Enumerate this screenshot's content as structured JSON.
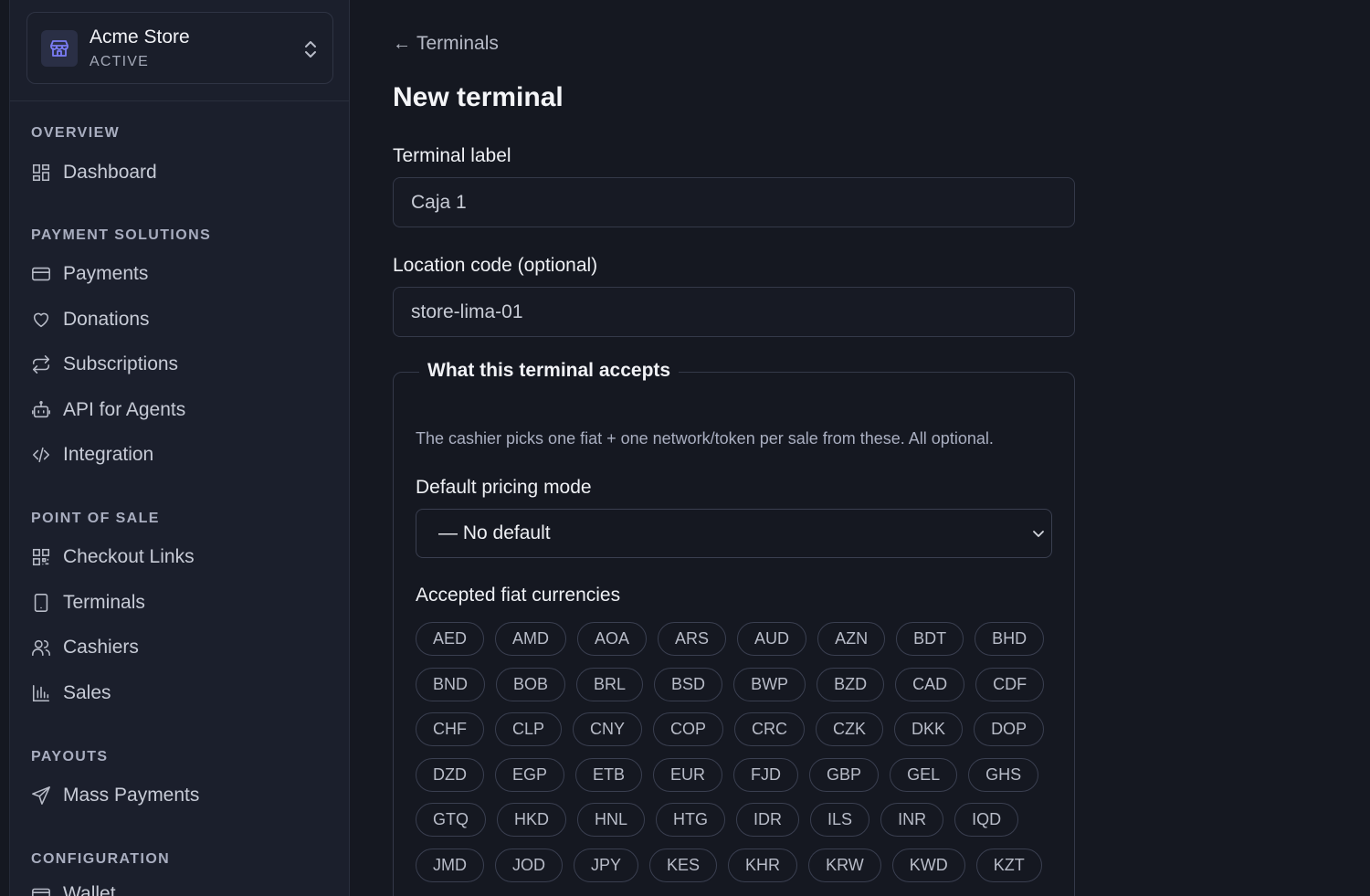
{
  "store": {
    "name": "Acme Store",
    "status": "ACTIVE"
  },
  "sidebar": {
    "sections": [
      {
        "title": "OVERVIEW",
        "items": [
          {
            "label": "Dashboard",
            "icon": "dashboard-icon"
          }
        ]
      },
      {
        "title": "PAYMENT SOLUTIONS",
        "items": [
          {
            "label": "Payments",
            "icon": "credit-card-icon"
          },
          {
            "label": "Donations",
            "icon": "heart-icon"
          },
          {
            "label": "Subscriptions",
            "icon": "repeat-icon"
          },
          {
            "label": "API for Agents",
            "icon": "robot-icon"
          },
          {
            "label": "Integration",
            "icon": "code-icon"
          }
        ]
      },
      {
        "title": "POINT OF SALE",
        "items": [
          {
            "label": "Checkout Links",
            "icon": "qr-code-icon"
          },
          {
            "label": "Terminals",
            "icon": "tablet-icon"
          },
          {
            "label": "Cashiers",
            "icon": "users-icon"
          },
          {
            "label": "Sales",
            "icon": "bar-chart-icon"
          }
        ]
      },
      {
        "title": "PAYOUTS",
        "items": [
          {
            "label": "Mass Payments",
            "icon": "send-icon"
          }
        ]
      },
      {
        "title": "CONFIGURATION",
        "items": [
          {
            "label": "Wallet",
            "icon": "wallet-icon"
          }
        ]
      }
    ]
  },
  "main": {
    "back_label": "Terminals",
    "title": "New terminal",
    "terminal_label": {
      "label": "Terminal label",
      "value": "Caja 1"
    },
    "location_code": {
      "label": "Location code (optional)",
      "value": "store-lima-01"
    },
    "accepts": {
      "legend": "What this terminal accepts",
      "description": "The cashier picks one fiat + one network/token per sale from these. All optional.",
      "pricing_label": "Default pricing mode",
      "pricing_value": "— No default",
      "fiat_label": "Accepted fiat currencies",
      "fiat_rows": [
        [
          "AED",
          "AMD",
          "AOA",
          "ARS",
          "AUD",
          "AZN",
          "BDT",
          "BHD"
        ],
        [
          "BND",
          "BOB",
          "BRL",
          "BSD",
          "BWP",
          "BZD",
          "CAD",
          "CDF"
        ],
        [
          "CHF",
          "CLP",
          "CNY",
          "COP",
          "CRC",
          "CZK",
          "DKK",
          "DOP"
        ],
        [
          "DZD",
          "EGP",
          "ETB",
          "EUR",
          "FJD",
          "GBP",
          "GEL",
          "GHS"
        ],
        [
          "GTQ",
          "HKD",
          "HNL",
          "HTG",
          "IDR",
          "ILS",
          "INR",
          "IQD"
        ],
        [
          "JMD",
          "JOD",
          "JPY",
          "KES",
          "KHR",
          "KRW",
          "KWD",
          "KZT"
        ]
      ]
    }
  },
  "colors": {
    "accent": "#6b6cf2",
    "background": "#151821",
    "sidebar": "#1b1f2c"
  }
}
